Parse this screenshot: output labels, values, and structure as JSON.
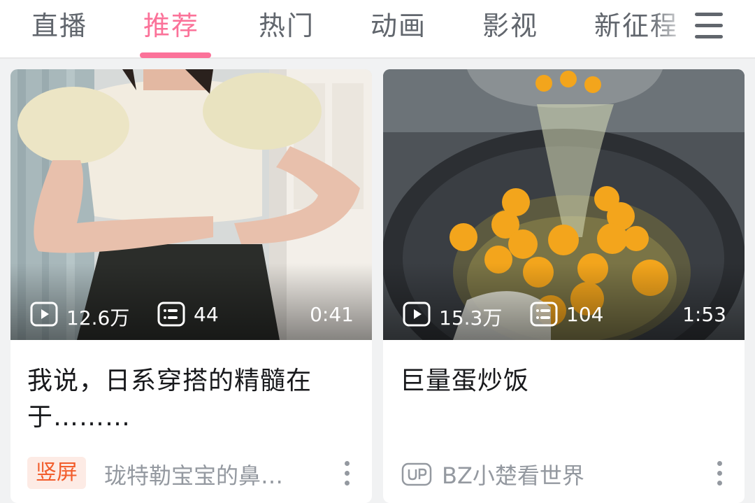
{
  "tabs": [
    {
      "label": "直播",
      "active": false
    },
    {
      "label": "推荐",
      "active": true
    },
    {
      "label": "热门",
      "active": false
    },
    {
      "label": "动画",
      "active": false
    },
    {
      "label": "影视",
      "active": false
    },
    {
      "label": "新征程",
      "active": false
    }
  ],
  "menu_icon": "hamburger-menu-icon",
  "colors": {
    "accent": "#fb7299",
    "text": "#18191c",
    "muted": "#9499a0",
    "badge_bg": "#fdebe5",
    "badge_text": "#f25d2c"
  },
  "cards": [
    {
      "views": "12.6万",
      "comments": "44",
      "duration": "0:41",
      "title": "我说，日系穿搭的精髓在于………",
      "badge": "竖屏",
      "author": "珑特勒宝宝的鼻…"
    },
    {
      "views": "15.3万",
      "comments": "104",
      "duration": "1:53",
      "title": "巨量蛋炒饭",
      "badge_icon": "up-icon",
      "author": "BZ小楚看世界"
    }
  ]
}
